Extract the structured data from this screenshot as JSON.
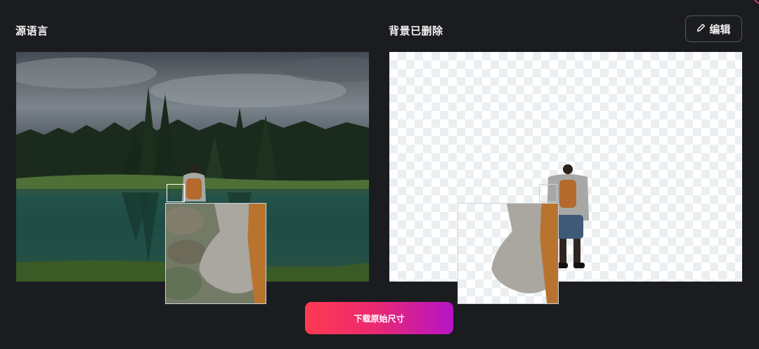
{
  "source_panel": {
    "label": "源语言"
  },
  "result_panel": {
    "label": "背景已删除"
  },
  "edit_button": {
    "label": "编辑",
    "icon": "pencil-icon"
  },
  "download_button": {
    "label": "下载原始尺寸"
  },
  "colors": {
    "background": "#1b1c1f",
    "button_gradient_start": "#fe3a52",
    "button_gradient_end": "#b614c6",
    "edit_border": "#55585e"
  }
}
